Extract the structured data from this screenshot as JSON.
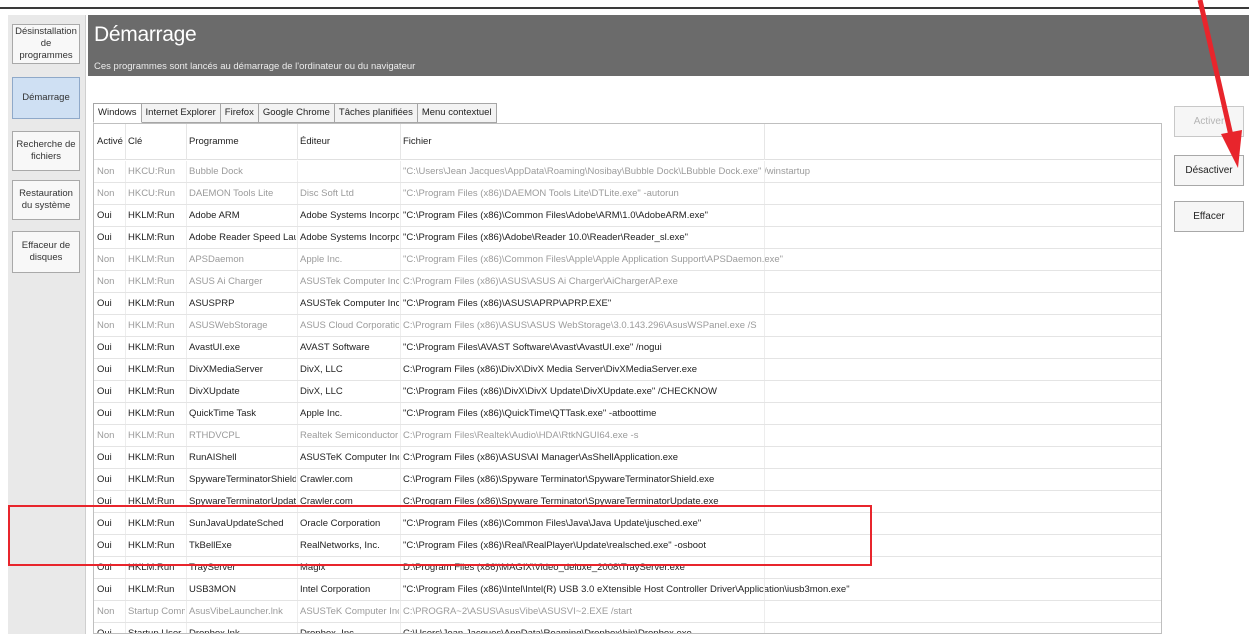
{
  "header": {
    "title": "Démarrage",
    "subtitle": "Ces programmes sont lancés au démarrage de l'ordinateur ou du navigateur"
  },
  "sidebar": {
    "items": [
      {
        "label": "Désinstallation de programmes"
      },
      {
        "label": "Démarrage"
      },
      {
        "label": "Recherche de fichiers"
      },
      {
        "label": "Restauration du système"
      },
      {
        "label": "Effaceur de disques"
      }
    ]
  },
  "tabs": [
    "Windows",
    "Internet Explorer",
    "Firefox",
    "Google Chrome",
    "Tâches planifiées",
    "Menu contextuel"
  ],
  "columns": {
    "active": "Activé",
    "key": "Clé",
    "program": "Programme",
    "publisher": "Éditeur",
    "file": "Fichier"
  },
  "rows": [
    {
      "active": "Non",
      "key": "HKCU:Run",
      "program": "Bubble Dock",
      "publisher": "",
      "file": "\"C:\\Users\\Jean Jacques\\AppData\\Roaming\\Nosibay\\Bubble Dock\\LBubble Dock.exe\" /winstartup"
    },
    {
      "active": "Non",
      "key": "HKCU:Run",
      "program": "DAEMON Tools Lite",
      "publisher": "Disc Soft Ltd",
      "file": "\"C:\\Program Files (x86)\\DAEMON Tools Lite\\DTLite.exe\" -autorun"
    },
    {
      "active": "Oui",
      "key": "HKLM:Run",
      "program": "Adobe ARM",
      "publisher": "Adobe Systems Incorporated",
      "file": "\"C:\\Program Files (x86)\\Common Files\\Adobe\\ARM\\1.0\\AdobeARM.exe\""
    },
    {
      "active": "Oui",
      "key": "HKLM:Run",
      "program": "Adobe Reader Speed Launcher",
      "publisher": "Adobe Systems Incorporated",
      "file": "\"C:\\Program Files (x86)\\Adobe\\Reader 10.0\\Reader\\Reader_sl.exe\""
    },
    {
      "active": "Non",
      "key": "HKLM:Run",
      "program": "APSDaemon",
      "publisher": "Apple Inc.",
      "file": "\"C:\\Program Files (x86)\\Common Files\\Apple\\Apple Application Support\\APSDaemon.exe\""
    },
    {
      "active": "Non",
      "key": "HKLM:Run",
      "program": "ASUS Ai Charger",
      "publisher": "ASUSTek Computer Inc.",
      "file": "C:\\Program Files (x86)\\ASUS\\ASUS Ai Charger\\AiChargerAP.exe"
    },
    {
      "active": "Oui",
      "key": "HKLM:Run",
      "program": "ASUSPRP",
      "publisher": "ASUSTek Computer Inc.",
      "file": "\"C:\\Program Files (x86)\\ASUS\\APRP\\APRP.EXE\""
    },
    {
      "active": "Non",
      "key": "HKLM:Run",
      "program": "ASUSWebStorage",
      "publisher": "ASUS Cloud Corporation",
      "file": "C:\\Program Files (x86)\\ASUS\\ASUS WebStorage\\3.0.143.296\\AsusWSPanel.exe /S"
    },
    {
      "active": "Oui",
      "key": "HKLM:Run",
      "program": "AvastUI.exe",
      "publisher": "AVAST Software",
      "file": "\"C:\\Program Files\\AVAST Software\\Avast\\AvastUI.exe\" /nogui"
    },
    {
      "active": "Oui",
      "key": "HKLM:Run",
      "program": "DivXMediaServer",
      "publisher": "DivX, LLC",
      "file": "C:\\Program Files (x86)\\DivX\\DivX Media Server\\DivXMediaServer.exe"
    },
    {
      "active": "Oui",
      "key": "HKLM:Run",
      "program": "DivXUpdate",
      "publisher": "DivX, LLC",
      "file": "\"C:\\Program Files (x86)\\DivX\\DivX Update\\DivXUpdate.exe\" /CHECKNOW"
    },
    {
      "active": "Oui",
      "key": "HKLM:Run",
      "program": "QuickTime Task",
      "publisher": "Apple Inc.",
      "file": "\"C:\\Program Files (x86)\\QuickTime\\QTTask.exe\" -atboottime"
    },
    {
      "active": "Non",
      "key": "HKLM:Run",
      "program": "RTHDVCPL",
      "publisher": "Realtek Semiconductor",
      "file": "C:\\Program Files\\Realtek\\Audio\\HDA\\RtkNGUI64.exe -s"
    },
    {
      "active": "Oui",
      "key": "HKLM:Run",
      "program": "RunAIShell",
      "publisher": "ASUSTeK Computer Inc.",
      "file": "C:\\Program Files (x86)\\ASUS\\AI Manager\\AsShellApplication.exe"
    },
    {
      "active": "Oui",
      "key": "HKLM:Run",
      "program": "SpywareTerminatorShield",
      "publisher": "Crawler.com",
      "file": "C:\\Program Files (x86)\\Spyware Terminator\\SpywareTerminatorShield.exe"
    },
    {
      "active": "Oui",
      "key": "HKLM:Run",
      "program": "SpywareTerminatorUpdater",
      "publisher": "Crawler.com",
      "file": "C:\\Program Files (x86)\\Spyware Terminator\\SpywareTerminatorUpdate.exe"
    },
    {
      "active": "Oui",
      "key": "HKLM:Run",
      "program": "SunJavaUpdateSched",
      "publisher": "Oracle Corporation",
      "file": "\"C:\\Program Files (x86)\\Common Files\\Java\\Java Update\\jusched.exe\""
    },
    {
      "active": "Oui",
      "key": "HKLM:Run",
      "program": "TkBellExe",
      "publisher": "RealNetworks, Inc.",
      "file": "\"C:\\Program Files (x86)\\Real\\RealPlayer\\Update\\realsched.exe\" -osboot"
    },
    {
      "active": "Oui",
      "key": "HKLM:Run",
      "program": "TrayServer",
      "publisher": "Magix",
      "file": "D:\\Program Files (x86)\\MAGIX\\Video_deluxe_2008\\TrayServer.exe"
    },
    {
      "active": "Oui",
      "key": "HKLM:Run",
      "program": "USB3MON",
      "publisher": "Intel Corporation",
      "file": "\"C:\\Program Files (x86)\\Intel\\Intel(R) USB 3.0 eXtensible Host Controller Driver\\Application\\iusb3mon.exe\""
    },
    {
      "active": "Non",
      "key": "Startup Common",
      "program": "AsusVibeLauncher.lnk",
      "publisher": "ASUSTeK Computer Inc.",
      "file": "C:\\PROGRA~2\\ASUS\\AsusVibe\\ASUSVI~2.EXE /start"
    },
    {
      "active": "Oui",
      "key": "Startup User",
      "program": "Dropbox.lnk",
      "publisher": "Dropbox, Inc.",
      "file": "C:\\Users\\Jean Jacques\\AppData\\Roaming\\Dropbox\\bin\\Dropbox.exe"
    }
  ],
  "actions": {
    "enable": "Activer",
    "disable": "Désactiver",
    "delete": "Effacer"
  },
  "colors": {
    "header_bg": "#6b6b6b",
    "highlight": "#e8252c",
    "arrow": "#e8252c"
  }
}
